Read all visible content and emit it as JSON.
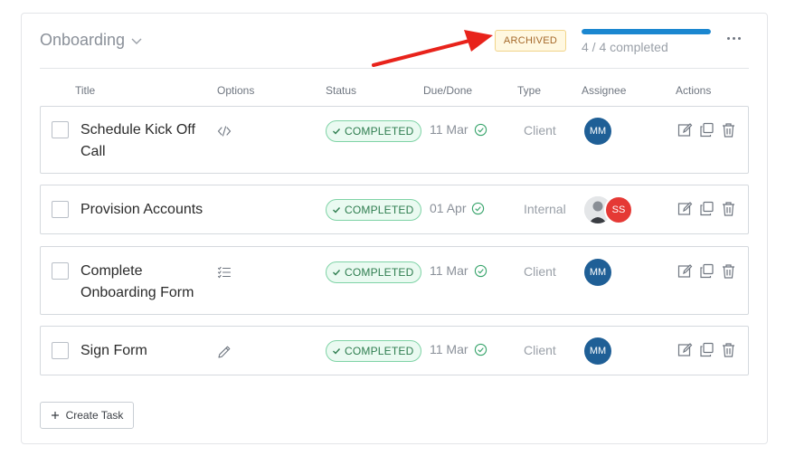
{
  "section": {
    "title": "Onboarding",
    "badge": "ARCHIVED",
    "progress_fraction": 1.0,
    "progress_text": "4 / 4 completed"
  },
  "columns": {
    "title": "Title",
    "options": "Options",
    "status": "Status",
    "due": "Due/Done",
    "type": "Type",
    "assignee": "Assignee",
    "actions": "Actions"
  },
  "tasks": [
    {
      "title": "Schedule Kick Off Call",
      "option_icon": "code-icon",
      "status": "COMPLETED",
      "due": "11 Mar",
      "type": "Client",
      "assignees": [
        "MM"
      ]
    },
    {
      "title": "Provision Accounts",
      "option_icon": "",
      "status": "COMPLETED",
      "due": "01 Apr",
      "type": "Internal",
      "assignees": [
        "photo",
        "SS"
      ]
    },
    {
      "title": "Complete Onboarding Form",
      "option_icon": "checklist-icon",
      "status": "COMPLETED",
      "due": "11 Mar",
      "type": "Client",
      "assignees": [
        "MM"
      ]
    },
    {
      "title": "Sign Form",
      "option_icon": "pencil-icon",
      "status": "COMPLETED",
      "due": "11 Mar",
      "type": "Client",
      "assignees": [
        "MM"
      ]
    }
  ],
  "create_task_label": "Create Task",
  "colors": {
    "accent": "#1b87d0",
    "completed_green": "#2e7d4f",
    "avatar_mm": "#1f5f96",
    "avatar_ss": "#e53935",
    "archived_text": "#a5682a",
    "arrow_red": "#e8231b"
  }
}
